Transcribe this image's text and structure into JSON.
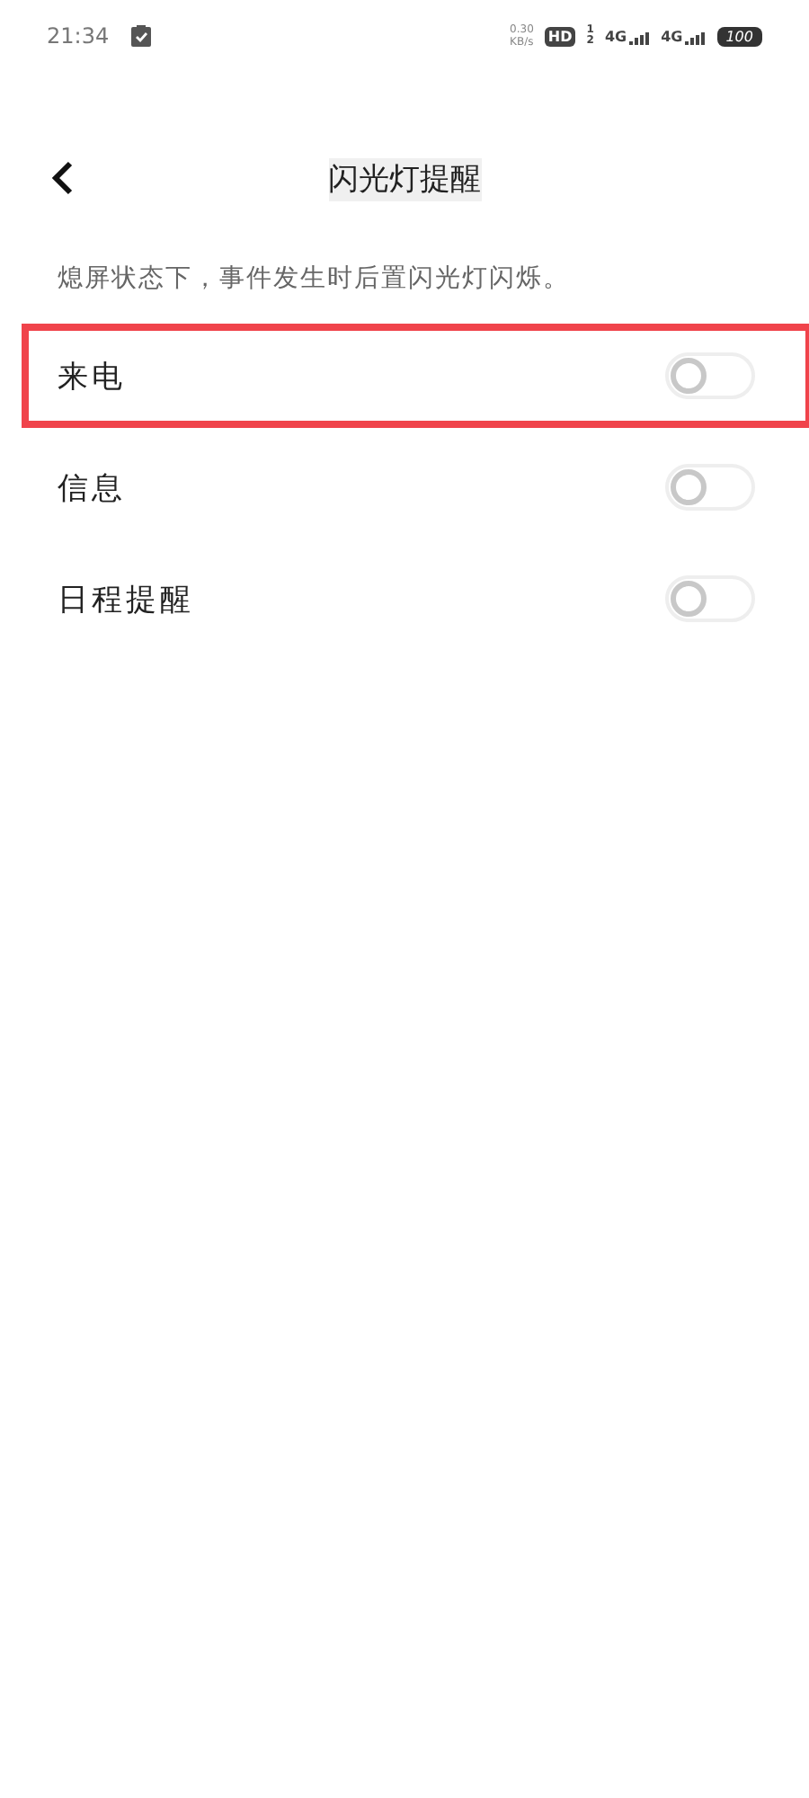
{
  "status_bar": {
    "time": "21:34",
    "speed_value": "0.30",
    "speed_unit": "KB/s",
    "hd": "HD",
    "sim_1": "1",
    "sim_2": "2",
    "network_1": "4G",
    "network_2": "4G",
    "battery": "100"
  },
  "header": {
    "title": "闪光灯提醒"
  },
  "description": "熄屏状态下，事件发生时后置闪光灯闪烁。",
  "settings": [
    {
      "label": "来电",
      "on": false,
      "highlighted": true
    },
    {
      "label": "信息",
      "on": false,
      "highlighted": false
    },
    {
      "label": "日程提醒",
      "on": false,
      "highlighted": false
    }
  ]
}
